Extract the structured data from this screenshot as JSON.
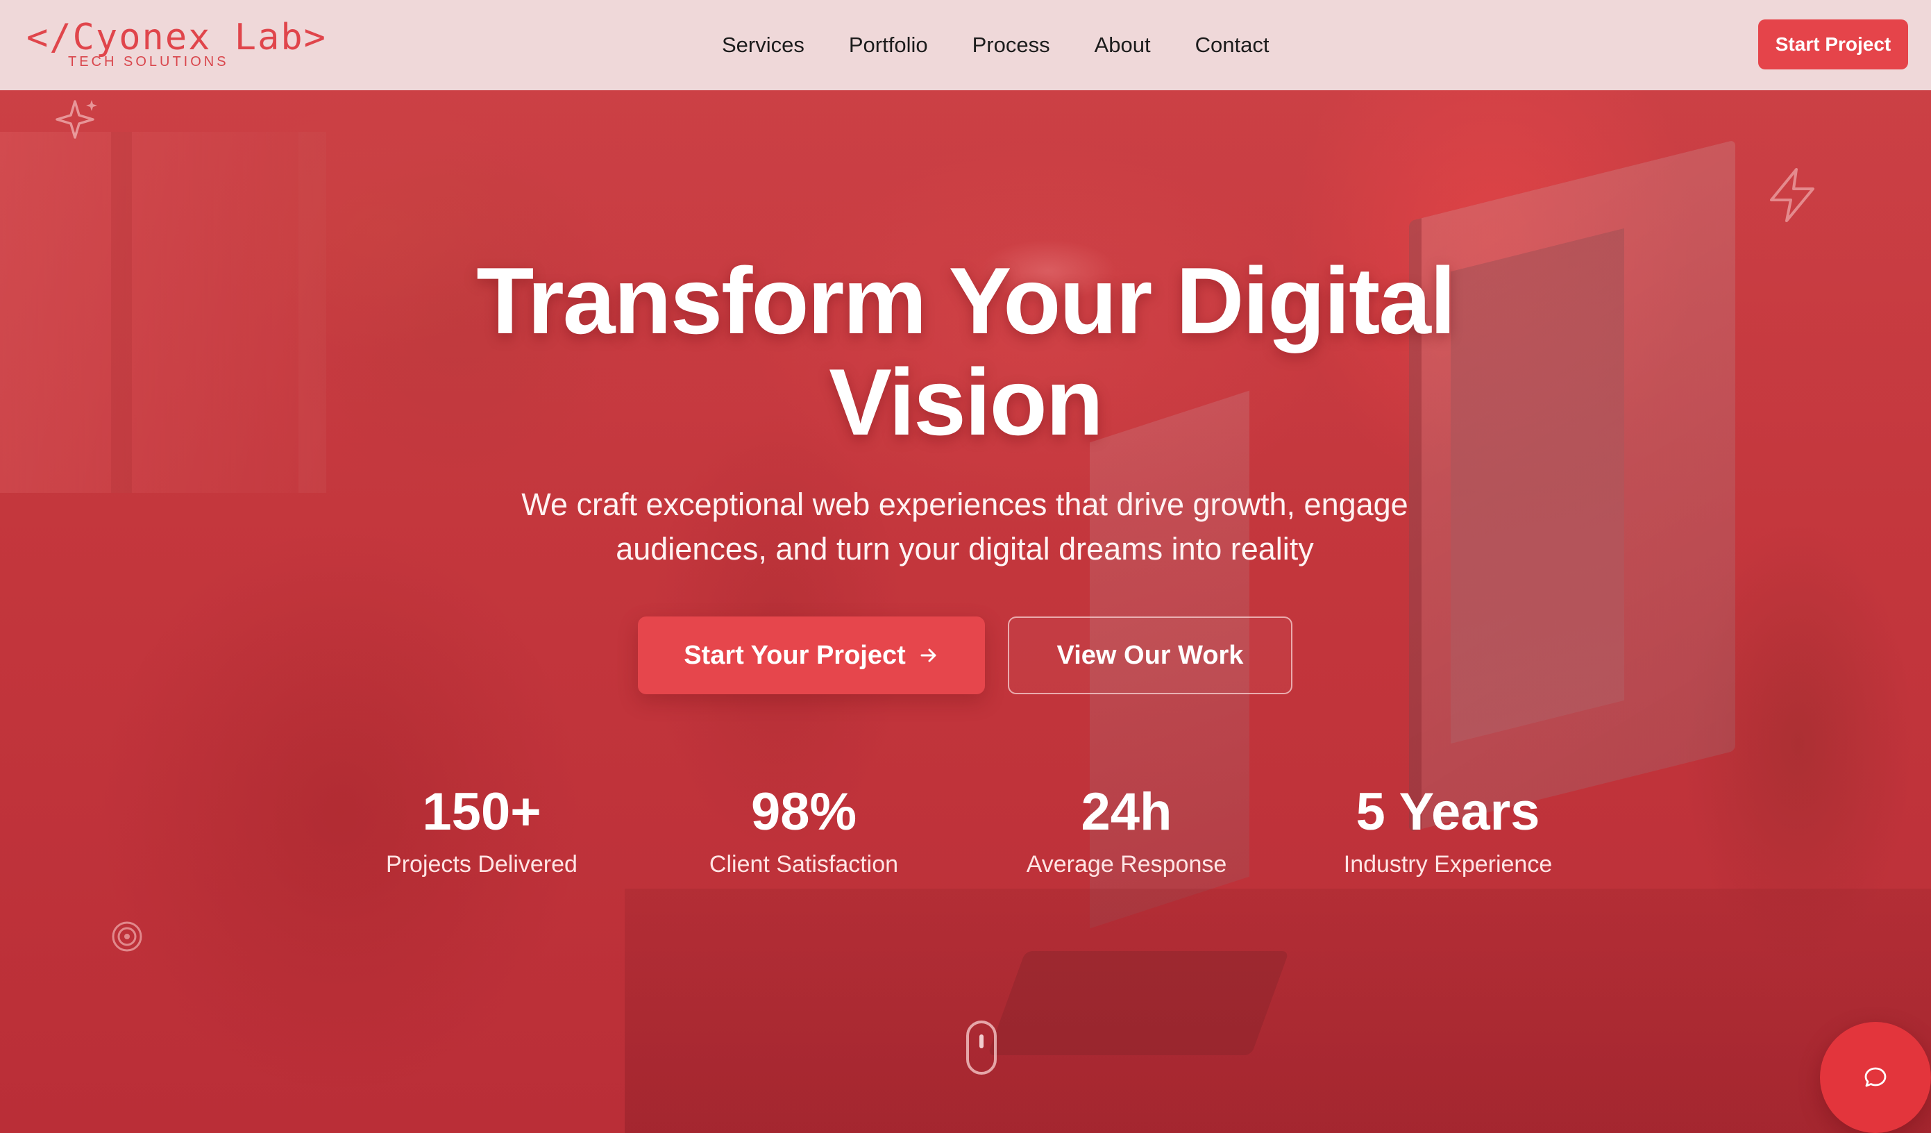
{
  "brand": {
    "logo_text": "</Cyonex Lab>",
    "tagline": "TECH SOLUTIONS",
    "accent_color": "#e5444a"
  },
  "nav": {
    "links": [
      "Services",
      "Portfolio",
      "Process",
      "About",
      "Contact"
    ],
    "cta_label": "Start Project"
  },
  "hero": {
    "headline_line1": "Transform Your Digital",
    "headline_line2": "Vision",
    "subheadline": "We craft exceptional web experiences that drive growth, engage audiences, and turn your digital dreams into reality",
    "primary_button": "Start Your Project",
    "primary_button_icon": "arrow-right-icon",
    "secondary_button": "View Our Work",
    "stats": [
      {
        "value": "150+",
        "label": "Projects Delivered"
      },
      {
        "value": "98%",
        "label": "Client Satisfaction"
      },
      {
        "value": "24h",
        "label": "Average Response"
      },
      {
        "value": "5 Years",
        "label": "Industry Experience"
      }
    ],
    "overlay_color": "#c4343a"
  },
  "decorations": {
    "icons": [
      "sparkle-icon",
      "lightning-icon",
      "target-icon",
      "scroll-mouse-icon"
    ]
  },
  "chat": {
    "icon": "chat-bubble-icon"
  }
}
